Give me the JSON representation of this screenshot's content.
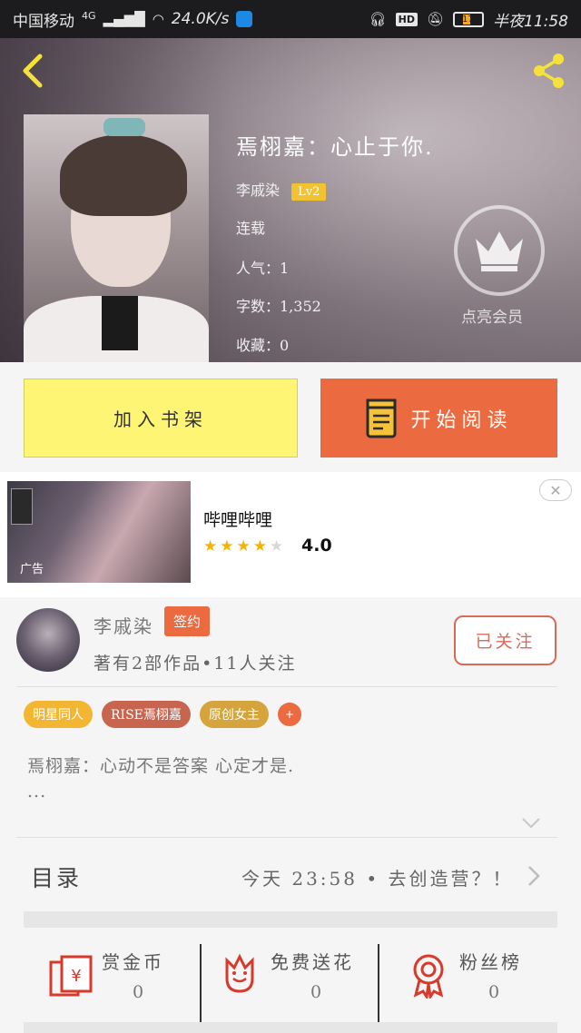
{
  "status_bar": {
    "carrier": "中国移动",
    "network": "4G",
    "speed": "24.0K/s",
    "battery": "17",
    "time": "半夜11:58"
  },
  "book": {
    "title": "焉栩嘉：心止于你.",
    "author": "李戚染",
    "level": "Lv2",
    "status": "连载",
    "popularity": "人气：1",
    "word_count": "字数：1,352",
    "favorites": "收藏：0",
    "vip_label": "点亮会员"
  },
  "actions": {
    "add_shelf": "加入书架",
    "start_read": "开始阅读"
  },
  "ad": {
    "title": "哔哩哔哩",
    "rating": "4.0",
    "stars": 4,
    "tag": "广告"
  },
  "author": {
    "name": "李戚染",
    "sign_badge": "签约",
    "subtitle": "著有2部作品•11人关注",
    "follow_label": "已关注"
  },
  "tags": [
    {
      "label": "明星同人",
      "color": "#f2b632"
    },
    {
      "label": "RISE焉栩嘉",
      "color": "#c8654f"
    },
    {
      "label": "原创女主",
      "color": "#d6a43c"
    }
  ],
  "tag_add": "+",
  "intro": {
    "line1": "焉栩嘉：心动不是答案 心定才是.",
    "line2": "..."
  },
  "toc": {
    "title": "目录",
    "latest": "今天 23:58 • 去创造营？！"
  },
  "rewards": [
    {
      "label": "赏金币",
      "value": "0"
    },
    {
      "label": "免费送花",
      "value": "0"
    },
    {
      "label": "粉丝榜",
      "value": "0"
    }
  ],
  "colors": {
    "accent_orange": "#ec6a3f",
    "shelf_yellow": "#fff575",
    "icon_red": "#d63a2a"
  }
}
